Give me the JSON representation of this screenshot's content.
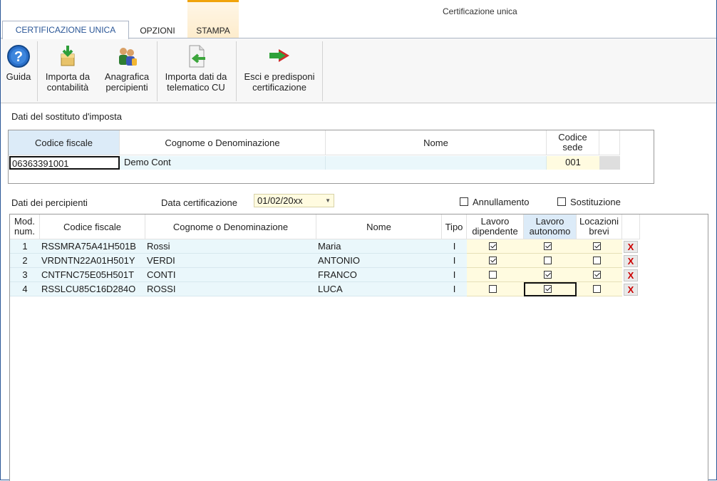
{
  "window": {
    "title": "Certificazione unica"
  },
  "tabs": [
    {
      "label": "CERTIFICAZIONE UNICA"
    },
    {
      "label": "OPZIONI"
    },
    {
      "label": "STAMPA"
    }
  ],
  "ribbon": {
    "guida": {
      "line1": "Guida",
      "icon": "help-icon"
    },
    "importa_contabilita": {
      "line1": "Importa da",
      "line2": "contabilità",
      "icon": "import-icon"
    },
    "anagrafica": {
      "line1": "Anagrafica",
      "line2": "percipienti",
      "icon": "people-icon"
    },
    "importa_telematico": {
      "line1": "Importa dati da",
      "line2": "telematico CU",
      "icon": "document-import-icon"
    },
    "esci": {
      "line1": "Esci e predisponi",
      "line2": "certificazione",
      "icon": "arrow-right-icon"
    }
  },
  "sostituto": {
    "section_label": "Dati del sostituto d'imposta",
    "headers": {
      "codice_fiscale": "Codice fiscale",
      "cognome": "Cognome o Denominazione",
      "nome": "Nome",
      "codice_sede_1": "Codice",
      "codice_sede_2": "sede"
    },
    "values": {
      "codice_fiscale": "06363391001",
      "cognome": "Demo Cont",
      "nome": "",
      "codice_sede": "001"
    }
  },
  "percipienti": {
    "section_label": "Dati dei percipienti",
    "data_cert_label": "Data certificazione",
    "data_cert_value": "01/02/20xx",
    "annullamento_label": "Annullamento",
    "sostituzione_label": "Sostituzione",
    "headers": {
      "mod_1": "Mod.",
      "mod_2": "num.",
      "codice_fiscale": "Codice fiscale",
      "cognome": "Cognome o Denominazione",
      "nome": "Nome",
      "tipo": "Tipo",
      "dip_1": "Lavoro",
      "dip_2": "dipendente",
      "aut_1": "Lavoro",
      "aut_2": "autonomo",
      "loc_1": "Locazioni",
      "loc_2": "brevi"
    },
    "rows": [
      {
        "num": "1",
        "cf": "RSSMRA75A41H501B",
        "cognome": "Rossi",
        "nome": "Maria",
        "tipo": "I",
        "dip": true,
        "aut": true,
        "loc": true,
        "del": "X"
      },
      {
        "num": "2",
        "cf": "VRDNTN22A01H501Y",
        "cognome": "VERDI",
        "nome": "ANTONIO",
        "tipo": "I",
        "dip": true,
        "aut": false,
        "loc": false,
        "del": "X"
      },
      {
        "num": "3",
        "cf": "CNTFNC75E05H501T",
        "cognome": "CONTI",
        "nome": "FRANCO",
        "tipo": "I",
        "dip": false,
        "aut": true,
        "loc": true,
        "del": "X"
      },
      {
        "num": "4",
        "cf": "RSSLCU85C16D284O",
        "cognome": "ROSSI",
        "nome": "LUCA",
        "tipo": "I",
        "dip": false,
        "aut": true,
        "loc": false,
        "del": "X"
      }
    ]
  }
}
